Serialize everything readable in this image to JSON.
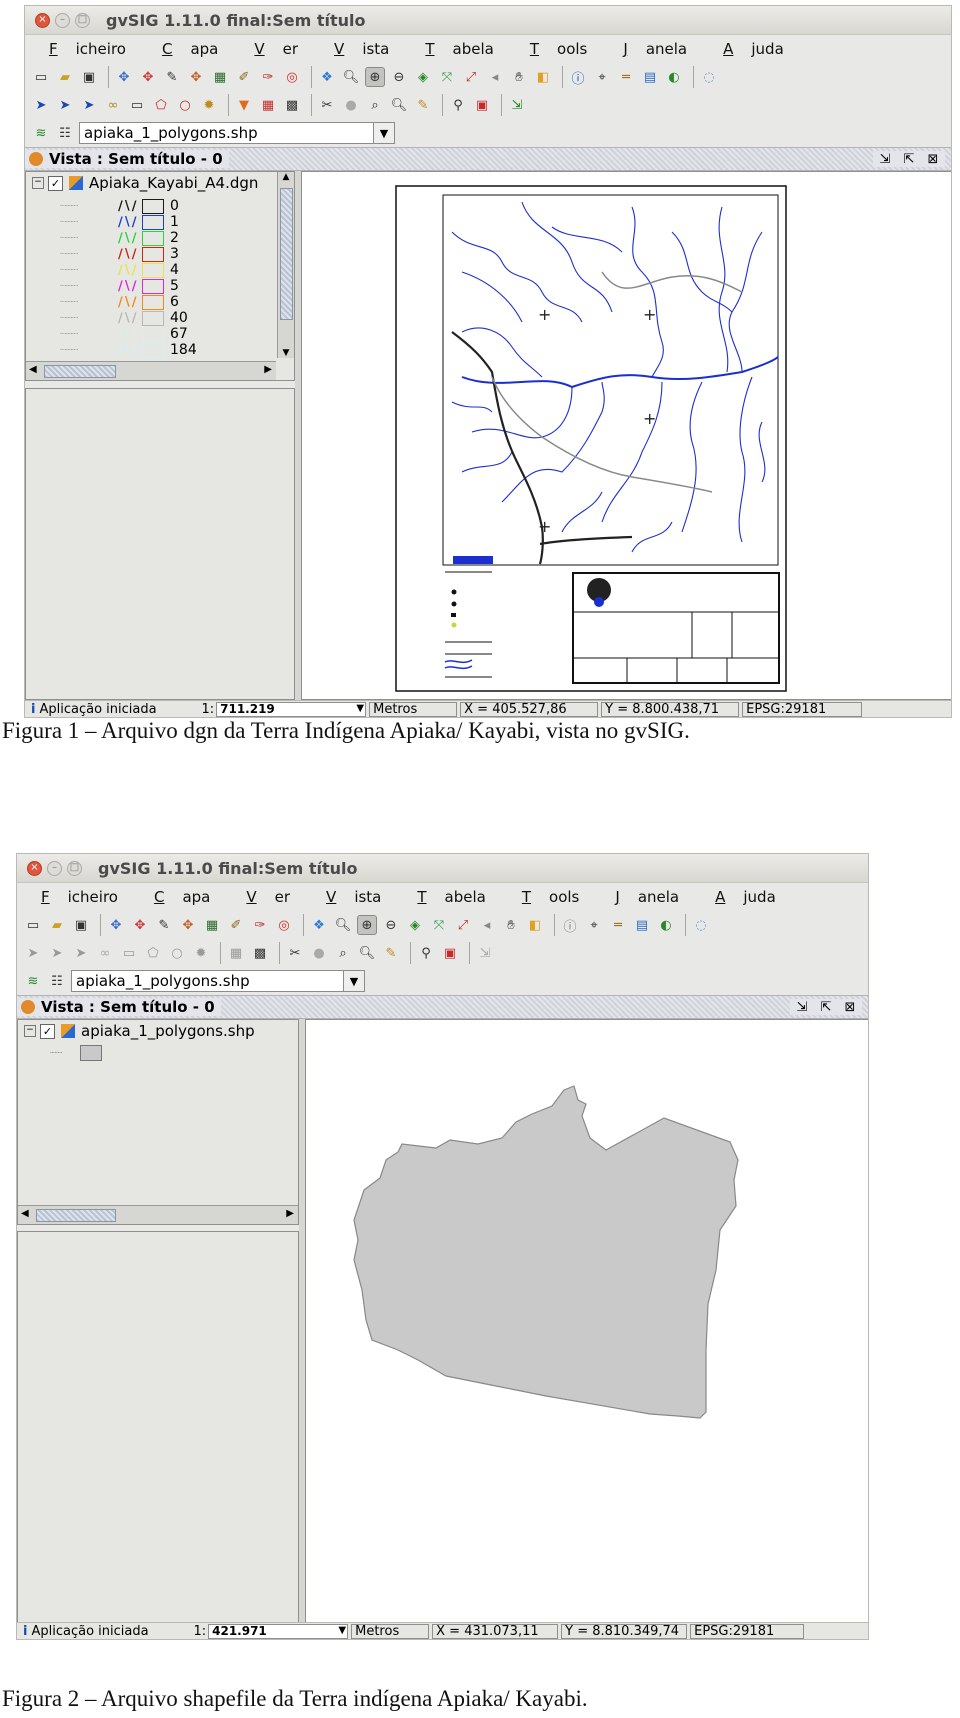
{
  "fig1": {
    "window_title": "gvSIG 1.11.0 final:Sem título",
    "menu": [
      {
        "u": "F",
        "rest": "icheiro"
      },
      {
        "u": "C",
        "rest": "apa"
      },
      {
        "u": "V",
        "rest": "er"
      },
      {
        "u": "V",
        "rest": "ista"
      },
      {
        "u": "T",
        "rest": "abela"
      },
      {
        "u": "T",
        "rest": "ools"
      },
      {
        "u": "J",
        "rest": "anela"
      },
      {
        "u": "A",
        "rest": "juda"
      }
    ],
    "layer_combo": "apiaka_1_polygons.shp",
    "view_title": "Vista : Sem título - 0",
    "toc_layer": "Apiaka_Kayabi_A4.dgn",
    "legend": [
      {
        "label": "0",
        "color": "#1a1a1a"
      },
      {
        "label": "1",
        "color": "#1f3fd0"
      },
      {
        "label": "2",
        "color": "#2bd43a"
      },
      {
        "label": "3",
        "color": "#c8261b"
      },
      {
        "label": "4",
        "color": "#e8e44a"
      },
      {
        "label": "5",
        "color": "#d82ad8"
      },
      {
        "label": "6",
        "color": "#f08a1c"
      },
      {
        "label": "40",
        "color": "#b8b8b4"
      },
      {
        "label": "67",
        "color": "#e0ece8"
      },
      {
        "label": "184",
        "color": "#d4f0f0"
      }
    ],
    "status": {
      "message": "Aplicação iniciada",
      "scale_prefix": "1:",
      "scale": "711.219",
      "units": "Metros",
      "x": "X = 405.527,86",
      "y": "Y = 8.800.438,71",
      "epsg": "EPSG:29181"
    },
    "caption": "Figura 1 – Arquivo dgn da Terra Indígena Apiaka/ Kayabi, vista no gvSIG."
  },
  "fig2": {
    "window_title": "gvSIG 1.11.0 final:Sem título",
    "menu": [
      {
        "u": "F",
        "rest": "icheiro"
      },
      {
        "u": "C",
        "rest": "apa"
      },
      {
        "u": "V",
        "rest": "er"
      },
      {
        "u": "V",
        "rest": "ista"
      },
      {
        "u": "T",
        "rest": "abela"
      },
      {
        "u": "T",
        "rest": "ools"
      },
      {
        "u": "J",
        "rest": "anela"
      },
      {
        "u": "A",
        "rest": "juda"
      }
    ],
    "layer_combo": "apiaka_1_polygons.shp",
    "view_title": "Vista : Sem título - 0",
    "toc_layer": "apiaka_1_polygons.shp",
    "polygon_fill": "#c9c9c9",
    "status": {
      "message": "Aplicação iniciada",
      "scale_prefix": "1:",
      "scale": "421.971",
      "units": "Metros",
      "x": "X = 431.073,11",
      "y": "Y = 8.810.349,74",
      "epsg": "EPSG:29181"
    },
    "caption": "Figura 2 – Arquivo shapefile da Terra indígena Apiaka/ Kayabi."
  },
  "icons_row1": [
    "new-file-icon",
    "open-file-icon",
    "save-icon",
    "add-layer-icon",
    "remove-layer-icon",
    "edit-icon",
    "layer-props-icon",
    "image-icon",
    "pencil-icon",
    "paint-icon",
    "target-icon",
    "catalog-icon",
    "zoom-select-icon",
    "zoom-in-icon",
    "zoom-out-icon",
    "layers-icon",
    "full-extent-icon",
    "zoom-extent-icon",
    "pan-back-icon",
    "hand-icon",
    "locator-icon",
    "info-icon",
    "coordinates-icon",
    "measure-icon",
    "area-icon",
    "globe-icon",
    "chat-icon"
  ],
  "icons_row2": [
    "select-icon",
    "select-point-icon",
    "select-polygon-icon",
    "select-link-icon",
    "rect-select-icon",
    "poly-select-icon",
    "circle-select-icon",
    "buffer-icon",
    "filter-icon",
    "table-icon",
    "grid-icon",
    "tools-icon",
    "hide-icon",
    "search-icon",
    "find-icon",
    "edit-table-icon",
    "zoom-magnifier-icon",
    "layout-icon",
    "export-icon"
  ]
}
